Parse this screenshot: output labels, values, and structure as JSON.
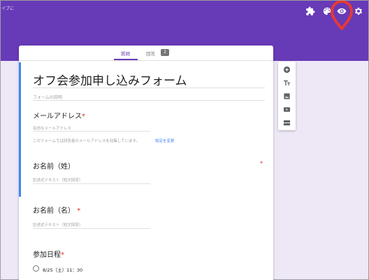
{
  "header": {
    "corner_text": "イブに",
    "background_color": "#673ab7",
    "icons": [
      "puzzle-icon",
      "palette-icon",
      "eye-icon",
      "gear-icon"
    ]
  },
  "tabs": [
    {
      "label": "質問",
      "active": true
    },
    {
      "label": "回答",
      "badge": "2",
      "active": false
    }
  ],
  "form": {
    "title": "オフ会参加申し込みフォーム",
    "description_placeholder": "フォームの説明"
  },
  "questions": [
    {
      "label": "メールアドレス",
      "required_mark": "*",
      "placeholder": "有効なメールアドレス",
      "note": "このフォームでは回答者のメールアドレスを収集しています。",
      "note_link": "設定を変更"
    },
    {
      "label": "お名前（姓）",
      "required_mark": "*",
      "placeholder": "記述式テキスト（短文回答）"
    },
    {
      "label": "お名前（名）",
      "required_mark": "*",
      "placeholder": "記述式テキスト（短文回答）"
    },
    {
      "label": "参加日程",
      "required_mark": "*",
      "options": [
        "8/25（土）11：30"
      ]
    }
  ],
  "side_toolbar": {
    "icons": [
      "add-question-icon",
      "title-text-icon",
      "image-icon",
      "video-icon",
      "section-icon"
    ]
  },
  "colors": {
    "accent": "#673ab7",
    "page_background": "#ede7f6",
    "focus_bar": "#4285f4",
    "highlight": "#e53935"
  }
}
